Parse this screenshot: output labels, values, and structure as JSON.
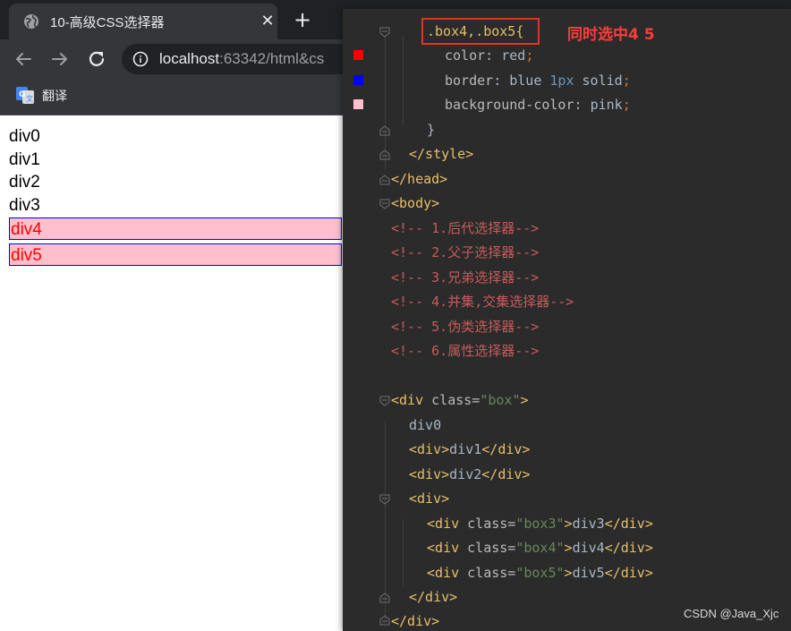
{
  "browser": {
    "tab_title": "10-高级CSS选择器",
    "tab_close": "✕",
    "new_tab": "+",
    "url_host": "localhost",
    "url_rest": ":63342/html&cs",
    "bookmark_label": "翻译"
  },
  "page": {
    "divs": [
      "div0",
      "div1",
      "div2",
      "div3",
      "div4",
      "div5"
    ]
  },
  "editor": {
    "annotation": "同时选中4 5",
    "swatch_colors": [
      "#ff0000",
      "#0000ff",
      "#ffc0cb"
    ],
    "lines": {
      "selector": ".box4,.box5{",
      "color_prop": "color",
      "color_val": "red",
      "border_prop": "border",
      "border_val1": "blue",
      "border_num": "1px",
      "border_val2": "solid",
      "bg_prop": "background-color",
      "bg_val": "pink",
      "close_brace": "}",
      "style_close": "</style>",
      "head_close": "</head>",
      "body_open": "<body>",
      "comments": [
        "<!-- 1.后代选择器-->",
        "<!-- 2.父子选择器-->",
        "<!-- 3.兄弟选择器-->",
        "<!-- 4.并集,交集选择器-->",
        "<!-- 5.伪类选择器-->",
        "<!-- 6.属性选择器-->"
      ],
      "div_box_tag": "<div",
      "div_box_attr": "class=",
      "div_box_str": "\"box\"",
      "div_box_end": ">",
      "div0": "div0",
      "div1_open": "<div>",
      "div1_text": "div1",
      "div1_close": "</div>",
      "div2_open": "<div>",
      "div2_text": "div2",
      "div2_close": "</div>",
      "div_open": "<div>",
      "box3_tag": "<div",
      "box3_attr": "class=",
      "box3_str": "\"box3\"",
      "box3_gt": ">",
      "box3_text": "div3",
      "box3_close": "</div>",
      "box4_tag": "<div",
      "box4_attr": "class=",
      "box4_str": "\"box4\"",
      "box4_gt": ">",
      "box4_text": "div4",
      "box4_close": "</div>",
      "box5_tag": "<div",
      "box5_attr": "class=",
      "box5_str": "\"box5\"",
      "box5_gt": ">",
      "box5_text": "div5",
      "box5_close": "</div>",
      "div_inner_close": "</div>",
      "div_outer_close": "</div>"
    }
  },
  "watermark": "CSDN @Java_Xjc"
}
